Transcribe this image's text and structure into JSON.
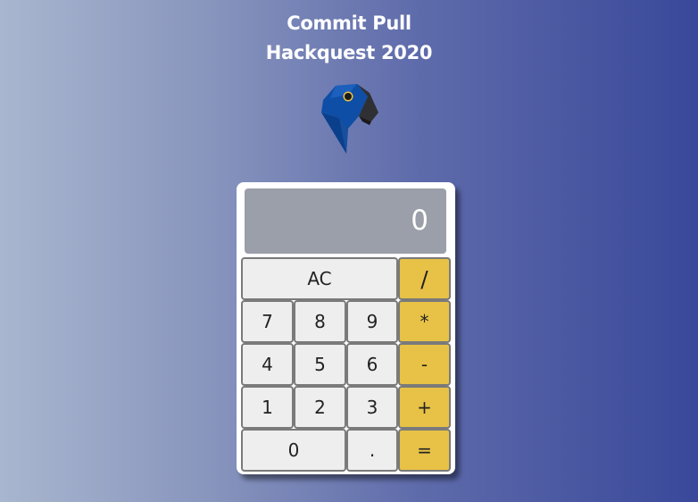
{
  "header": {
    "title_line1": "Commit Pull",
    "title_line2": "Hackquest 2020"
  },
  "logo": {
    "icon": "parrot-icon",
    "colors": {
      "body": "#0f4ea6",
      "beak": "#2b2b2b",
      "eye": "#e8c246"
    }
  },
  "calculator": {
    "display": "0",
    "keys": {
      "clear": "AC",
      "divide": "/",
      "multiply": "*",
      "subtract": "-",
      "add": "+",
      "equals": "=",
      "decimal": ".",
      "d0": "0",
      "d1": "1",
      "d2": "2",
      "d3": "3",
      "d4": "4",
      "d5": "5",
      "d6": "6",
      "d7": "7",
      "d8": "8",
      "d9": "9"
    },
    "colors": {
      "operator_key": "#e8c246",
      "number_key": "#eeeeee",
      "display_bg": "#9a9fa9"
    }
  }
}
